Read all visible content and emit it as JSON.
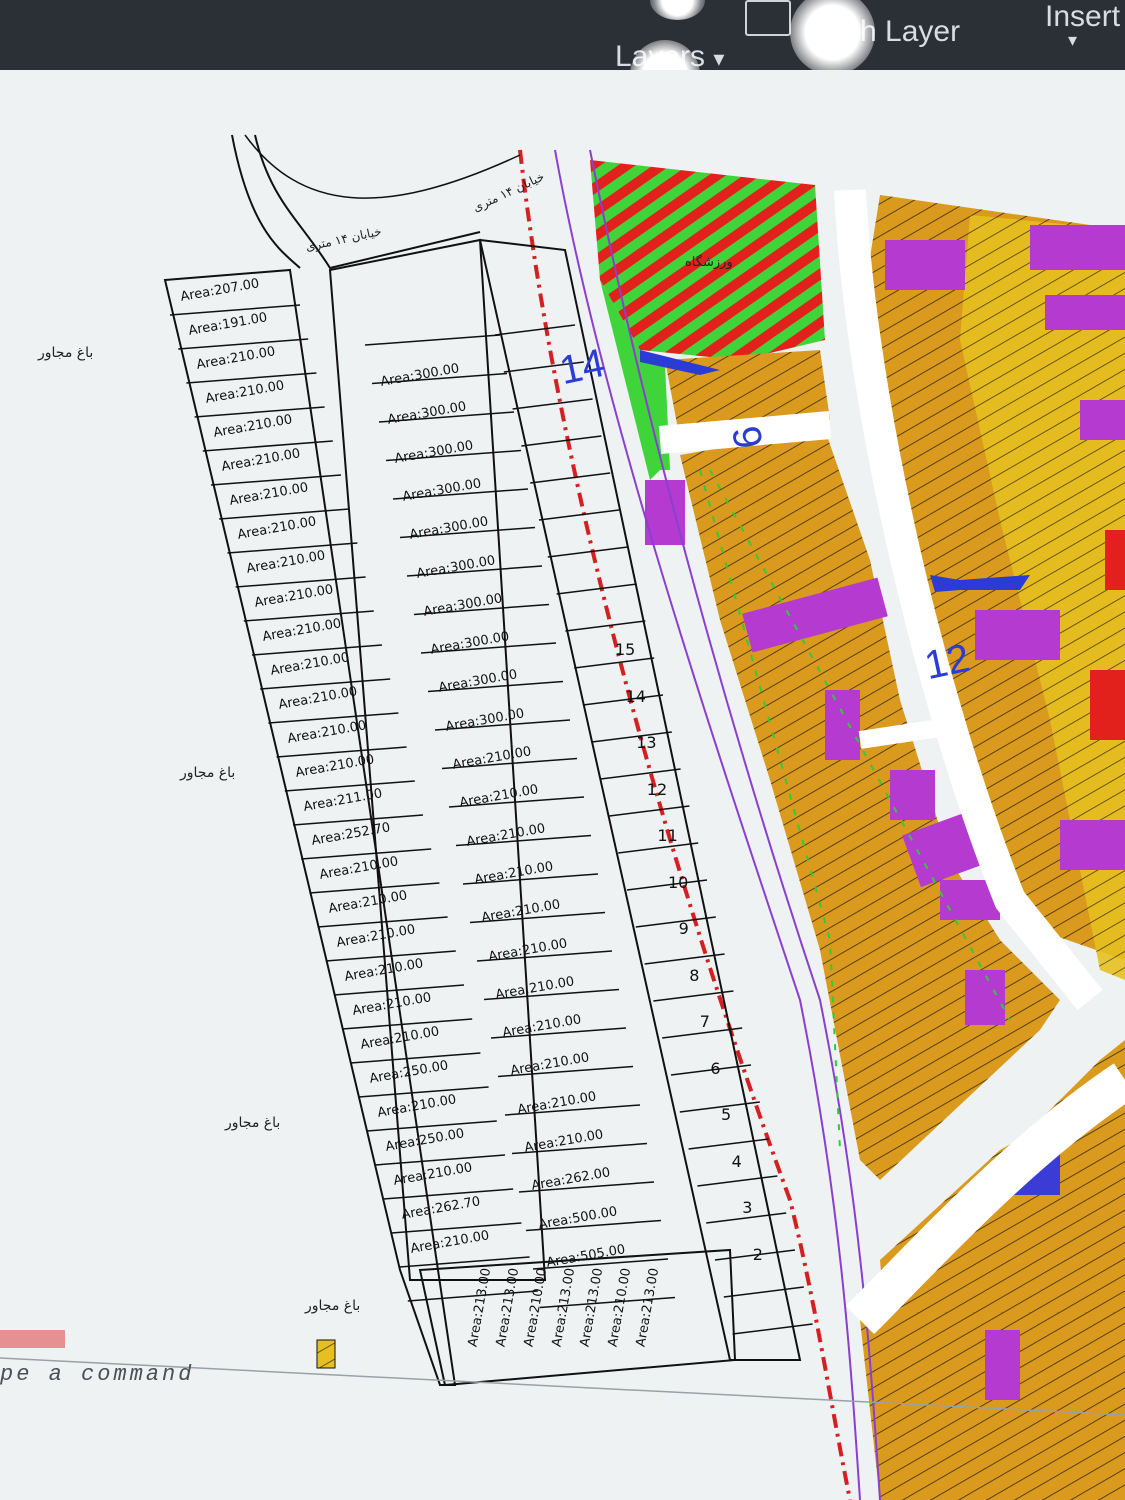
{
  "ribbon": {
    "layers_label": "Layers",
    "match_layer_label": "h Layer",
    "insert_label": "Insert",
    "dropdown_glyph": "▾"
  },
  "command_line": {
    "prompt": "pe a command"
  },
  "drawing": {
    "road_numbers": [
      "14",
      "9",
      "12"
    ],
    "neighbor_labels": [
      "باغ مجاور",
      "باغ مجاور",
      "باغ مجاور",
      "باغ مجاور"
    ],
    "street_labels": [
      "خیابان ۱۴ متری",
      "خیابان ۱۴ متری"
    ],
    "gym_label": "ورزشگاه",
    "left_column_areas": [
      "Area:207.00",
      "Area:191.00",
      "Area:210.00",
      "Area:210.00",
      "Area:210.00",
      "Area:210.00",
      "Area:210.00",
      "Area:210.00",
      "Area:210.00",
      "Area:210.00",
      "Area:210.00",
      "Area:210.00",
      "Area:210.00",
      "Area:210.00",
      "Area:210.00",
      "Area:211.00",
      "Area:252.70",
      "Area:210.00",
      "Area:210.00",
      "Area:210.00",
      "Area:210.00",
      "Area:210.00",
      "Area:210.00",
      "Area:250.00",
      "Area:210.00",
      "Area:250.00",
      "Area:210.00",
      "Area:262.70",
      "Area:210.00"
    ],
    "middle_column_areas": [
      "Area:300.00",
      "Area:300.00",
      "Area:300.00",
      "Area:300.00",
      "Area:300.00",
      "Area:300.00",
      "Area:300.00",
      "Area:300.00",
      "Area:300.00",
      "Area:300.00",
      "Area:210.00",
      "Area:210.00",
      "Area:210.00",
      "Area:210.00",
      "Area:210.00",
      "Area:210.00",
      "Area:210.00",
      "Area:210.00",
      "Area:210.00",
      "Area:210.00",
      "Area:210.00",
      "Area:262.00",
      "Area:500.00",
      "Area:505.00"
    ],
    "right_lot_numbers": [
      "15",
      "14",
      "13",
      "12",
      "11",
      "10",
      "9",
      "8",
      "7",
      "6",
      "5",
      "4",
      "3",
      "2"
    ],
    "bottom_row_areas": [
      "Area:213.00",
      "Area:213.00",
      "Area:210.00",
      "Area:213.00",
      "Area:213.00",
      "Area:210.00",
      "Area:213.00"
    ]
  },
  "colors": {
    "residential": "#d99a1e",
    "commercial": "#b43ad0",
    "green_space": "#3fd43a",
    "sport": "#e3211c",
    "yellow_zone": "#e6c020",
    "boundary_red": "#d42020",
    "road_purple": "#8a3fd0",
    "annotation_blue": "#2a3bd6"
  }
}
